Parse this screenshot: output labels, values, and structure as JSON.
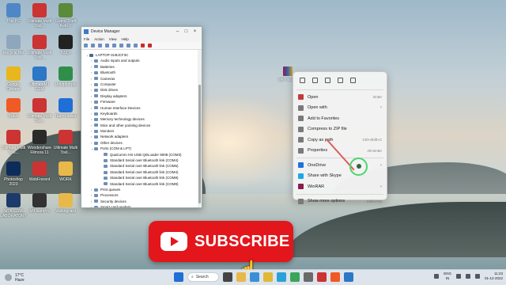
{
  "desktop": {
    "icons": [
      {
        "label": "This PC",
        "color": "#4f86c6"
      },
      {
        "label": "Ultimate Multi Tool...",
        "color": "#cc3333"
      },
      {
        "label": "Grand Theft Auto V",
        "color": "#5a8a3a"
      },
      {
        "label": "Recycle Bin",
        "color": "#8fa7bd"
      },
      {
        "label": "Ultimate Multi Tool...",
        "color": "#cc3333"
      },
      {
        "label": "NSDI",
        "color": "#222222"
      },
      {
        "label": "Google Chrome",
        "color": "#e8b61d"
      },
      {
        "label": "UltimateMT GSM",
        "color": "#2c77c6"
      },
      {
        "label": "Udefpfefrpls",
        "color": "#2f8f4a"
      },
      {
        "label": "Brave",
        "color": "#f05a24"
      },
      {
        "label": "Ultimate Multi Tool...",
        "color": "#cc3333"
      },
      {
        "label": "TeamViewer",
        "color": "#1f6fd6"
      },
      {
        "label": "Ultimate Multi Tool...",
        "color": "#cc3333"
      },
      {
        "label": "Wondershare Filmora 11",
        "color": "#2a2a2a"
      },
      {
        "label": "Ultimate Multi Tool...",
        "color": "#cc3333"
      },
      {
        "label": "Photoshop 2023",
        "color": "#0e2c5a"
      },
      {
        "label": "WebFrerent",
        "color": "#cc3333"
      },
      {
        "label": "WORK",
        "color": "#e8b84a"
      },
      {
        "label": "MTK GSM LABORATORY",
        "color": "#1c3a6a"
      },
      {
        "label": "MiFlashPro",
        "color": "#333333"
      },
      {
        "label": "Visitingcard",
        "color": "#e8b84a"
      }
    ],
    "selected_file": {
      "label": "MRT Tools_1..."
    }
  },
  "device_manager": {
    "title": "Device Manager",
    "menu": [
      "File",
      "Action",
      "View",
      "Help"
    ],
    "root": "LAPTOP-3U9JCF3C",
    "categories": [
      "Audio inputs and outputs",
      "Batteries",
      "Bluetooth",
      "Cameras",
      "Computer",
      "Disk drives",
      "Display adapters",
      "Firmware",
      "Human Interface Devices",
      "Keyboards",
      "Memory technology devices",
      "Mice and other pointing devices",
      "Monitors",
      "Network adapters",
      "Other devices",
      "Ports (COM & LPT)"
    ],
    "ports": [
      "Qualcomm HS-USB QDLoader 9008 (COM3)",
      "Standard Serial over Bluetooth link (COM4)",
      "Standard Serial over Bluetooth link (COM5)",
      "Standard Serial over Bluetooth link (COM4)",
      "Standard Serial over Bluetooth link (COM8)",
      "Standard Serial over Bluetooth link (COM9)"
    ],
    "after": [
      "Print queues",
      "Processors",
      "Security devices",
      "Smart card readers"
    ]
  },
  "context_menu": {
    "items": [
      {
        "label": "Open",
        "shortcut": "Enter",
        "icon_color": "#c43a3a",
        "submenu": false
      },
      {
        "label": "Open with",
        "shortcut": "",
        "icon_color": "#7a7a7a",
        "submenu": true
      },
      {
        "label": "Add to Favorites",
        "shortcut": "",
        "icon_color": "#7a7a7a",
        "submenu": false
      },
      {
        "label": "Compress to ZIP file",
        "shortcut": "",
        "icon_color": "#7a7a7a",
        "submenu": false
      },
      {
        "label": "Copy as path",
        "shortcut": "Ctrl+Shift+C",
        "icon_color": "#7a7a7a",
        "submenu": false
      },
      {
        "label": "Properties",
        "shortcut": "Alt+Enter",
        "icon_color": "#7a7a7a",
        "submenu": false
      },
      {
        "label": "OneDrive",
        "shortcut": "",
        "icon_color": "#1f73d6",
        "submenu": true
      },
      {
        "label": "Share with Skype",
        "shortcut": "",
        "icon_color": "#1ea7e6",
        "submenu": false
      },
      {
        "label": "WinRAR",
        "shortcut": "",
        "icon_color": "#8b1b4a",
        "submenu": true
      },
      {
        "label": "Show more options",
        "shortcut": "Shift+F10",
        "icon_color": "#7a7a7a",
        "submenu": false
      }
    ]
  },
  "overlay": {
    "subscribe_label": "SUBSCRIBE"
  },
  "taskbar": {
    "weather_temp": "17°C",
    "weather_desc": "Haze",
    "search_label": "Search",
    "lang": "ENG",
    "region": "IN",
    "time": "11:23",
    "date": "01-12-2022"
  }
}
